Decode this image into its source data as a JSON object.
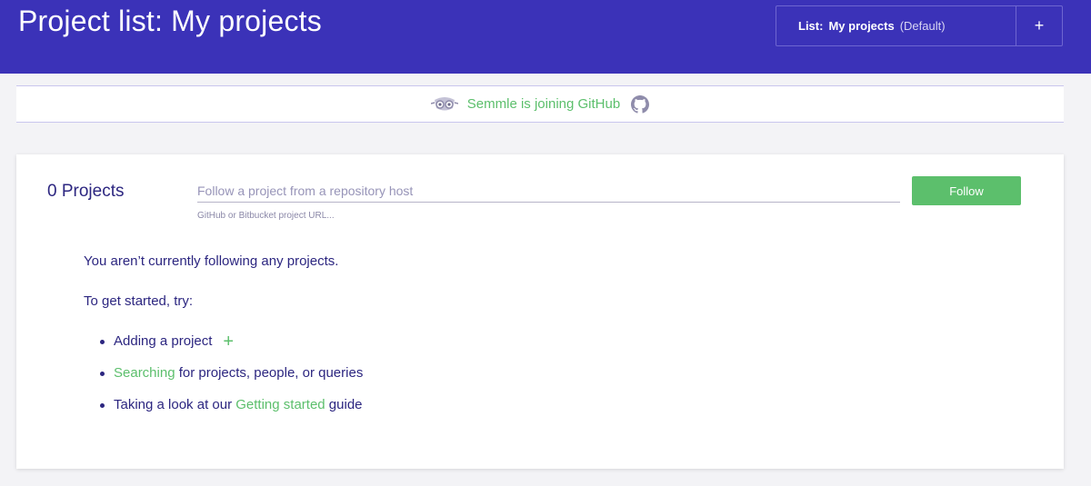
{
  "header": {
    "title": "Project list: My projects",
    "list_selector": {
      "prefix": "List:",
      "name": "My projects",
      "default_tag": "(Default)",
      "add_label": "+"
    }
  },
  "banner": {
    "text": "Semmle is joining GitHub",
    "icons": [
      "semmle-owl-icon",
      "github-icon"
    ]
  },
  "projects": {
    "count_label": "0 Projects",
    "follow_input": {
      "value": "",
      "placeholder": "Follow a project from a repository host"
    },
    "follow_hint": "GitHub or Bitbucket project URL...",
    "follow_button": "Follow"
  },
  "empty_state": {
    "message": "You aren’t currently following any projects.",
    "start_prompt": "To get started, try:",
    "suggestions": {
      "adding": "Adding a project",
      "searching_link": "Searching",
      "searching_rest": " for projects, people, or queries",
      "guide_pre": "Taking a look at our ",
      "guide_link": "Getting started",
      "guide_post": " guide"
    },
    "add_icon": "plus-icon"
  },
  "colors": {
    "header_bg": "#3b32b8",
    "accent_green": "#5cbf6c",
    "text_primary": "#2c2680"
  }
}
